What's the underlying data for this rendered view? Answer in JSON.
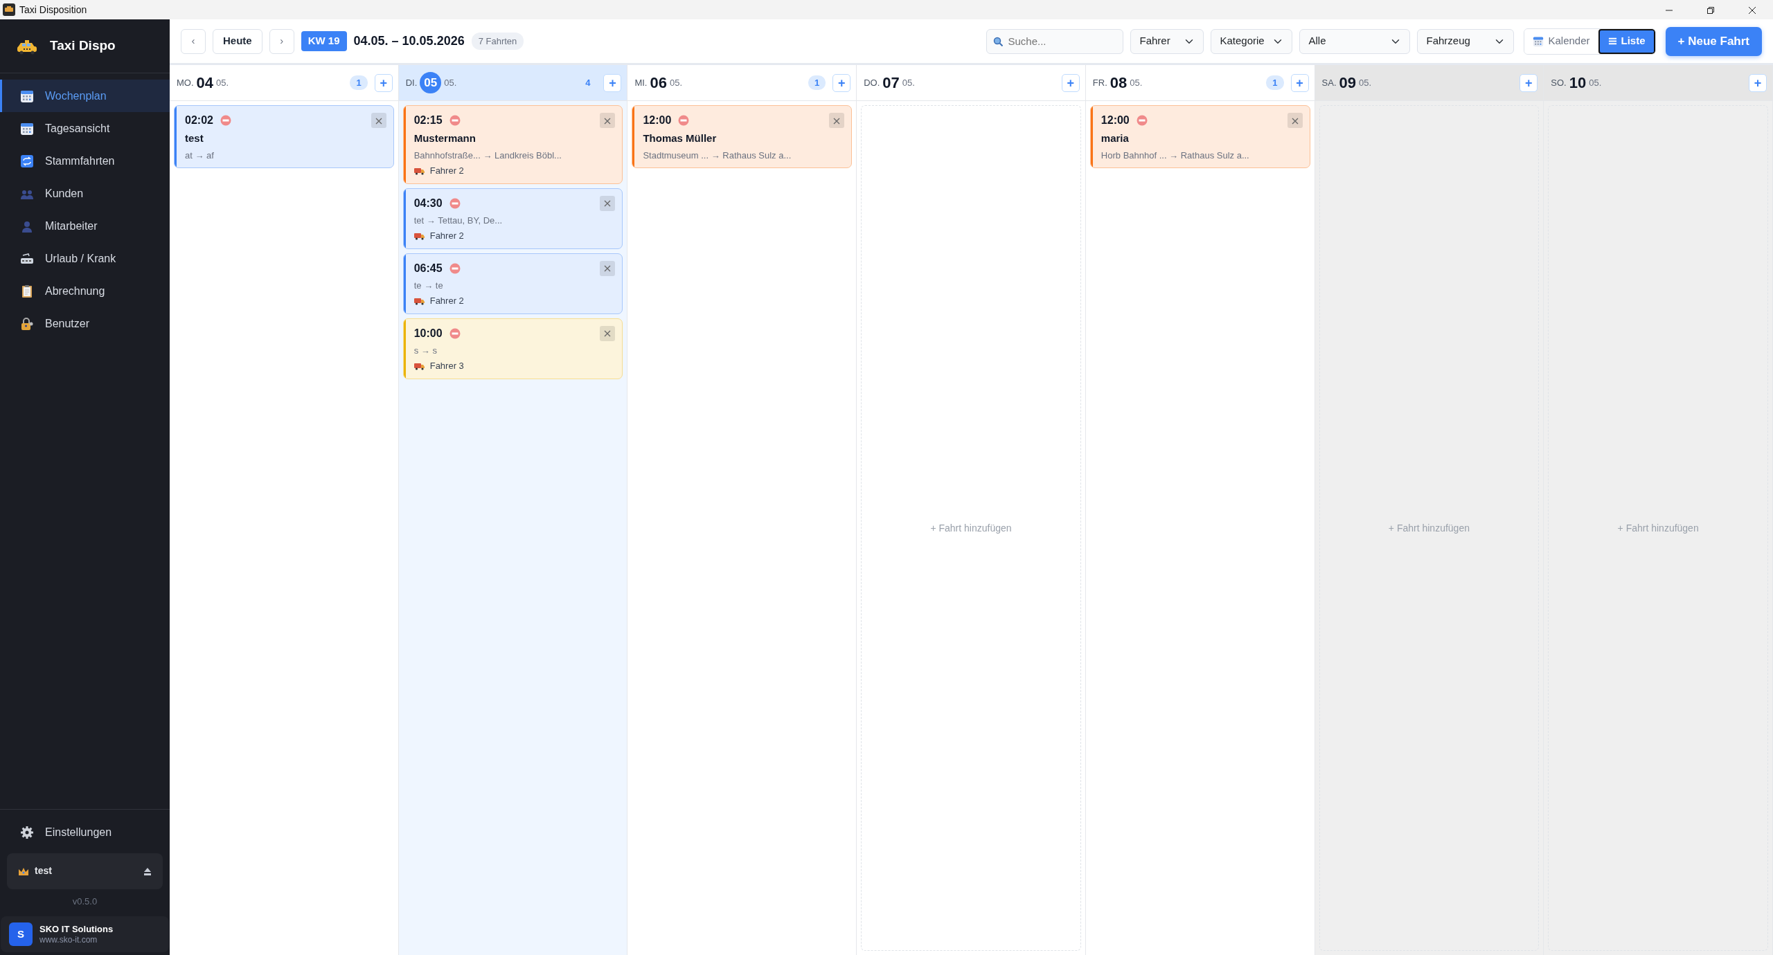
{
  "window": {
    "title": "Taxi Disposition"
  },
  "sidebar": {
    "brand": "Taxi Dispo",
    "items": [
      {
        "label": "Wochenplan",
        "selected": true
      },
      {
        "label": "Tagesansicht",
        "selected": false
      },
      {
        "label": "Stammfahrten",
        "selected": false
      },
      {
        "label": "Kunden",
        "selected": false
      },
      {
        "label": "Mitarbeiter",
        "selected": false
      },
      {
        "label": "Urlaub / Krank",
        "selected": false
      },
      {
        "label": "Abrechnung",
        "selected": false
      },
      {
        "label": "Benutzer",
        "selected": false
      }
    ],
    "settings": "Einstellungen",
    "user": "test",
    "version": "v0.5.0",
    "company": {
      "logo": "S",
      "name": "SKO IT Solutions",
      "url": "www.sko-it.com"
    }
  },
  "toolbar": {
    "today": "Heute",
    "prev": "‹",
    "next": "›",
    "week": "KW 19",
    "range": "04.05. – 10.05.2026",
    "count": "7 Fahrten",
    "search": {
      "placeholder": "Suche..."
    },
    "filters": [
      {
        "value": "Fahrer"
      },
      {
        "value": "Kategorie"
      },
      {
        "value": "Alle"
      },
      {
        "value": "Fahrzeug"
      }
    ],
    "views": [
      {
        "label": "Kalender",
        "selected": false
      },
      {
        "label": "Liste",
        "selected": true
      }
    ],
    "new": "+ Neue Fahrt"
  },
  "days": [
    {
      "weekday": "MO.",
      "day": "04",
      "month": "05.",
      "today": false,
      "weekend": false,
      "count": "1",
      "add": "+",
      "trips": [
        {
          "time": "02:02",
          "name": "test",
          "route": "at → af",
          "color": "#3b82f6"
        }
      ]
    },
    {
      "weekday": "DI.",
      "day": "05",
      "month": "05.",
      "today": true,
      "weekend": false,
      "count": "4",
      "add": "+",
      "trips": [
        {
          "time": "02:15",
          "name": "Mustermann",
          "route": "Bahnhofstraße... → Landkreis Böbl...",
          "driver": "Fahrer 2",
          "color": "#f97316"
        },
        {
          "time": "04:30",
          "route": "tet → Tettau, BY, De...",
          "driver": "Fahrer 2",
          "color": "#3b82f6"
        },
        {
          "time": "06:45",
          "route": "te → te",
          "driver": "Fahrer 2",
          "color": "#3b82f6"
        },
        {
          "time": "10:00",
          "route": "s → s",
          "driver": "Fahrer 3",
          "color": "#eab308"
        }
      ]
    },
    {
      "weekday": "MI.",
      "day": "06",
      "month": "05.",
      "today": false,
      "weekend": false,
      "count": "1",
      "add": "+",
      "trips": [
        {
          "time": "12:00",
          "name": "Thomas Müller",
          "route": "Stadtmuseum ... → Rathaus Sulz a...",
          "color": "#f97316"
        }
      ]
    },
    {
      "weekday": "DO.",
      "day": "07",
      "month": "05.",
      "today": false,
      "weekend": false,
      "add": "+",
      "empty_hint": "+ Fahrt hinzufügen"
    },
    {
      "weekday": "FR.",
      "day": "08",
      "month": "05.",
      "today": false,
      "weekend": false,
      "count": "1",
      "add": "+",
      "trips": [
        {
          "time": "12:00",
          "name": "maria",
          "route": "Horb Bahnhof ... → Rathaus Sulz a...",
          "color": "#f97316"
        }
      ]
    },
    {
      "weekday": "SA.",
      "day": "09",
      "month": "05.",
      "today": false,
      "weekend": true,
      "add": "+",
      "empty_hint": "+ Fahrt hinzufügen"
    },
    {
      "weekday": "SO.",
      "day": "10",
      "month": "05.",
      "today": false,
      "weekend": true,
      "add": "+",
      "empty_hint": "+ Fahrt hinzufügen"
    }
  ]
}
